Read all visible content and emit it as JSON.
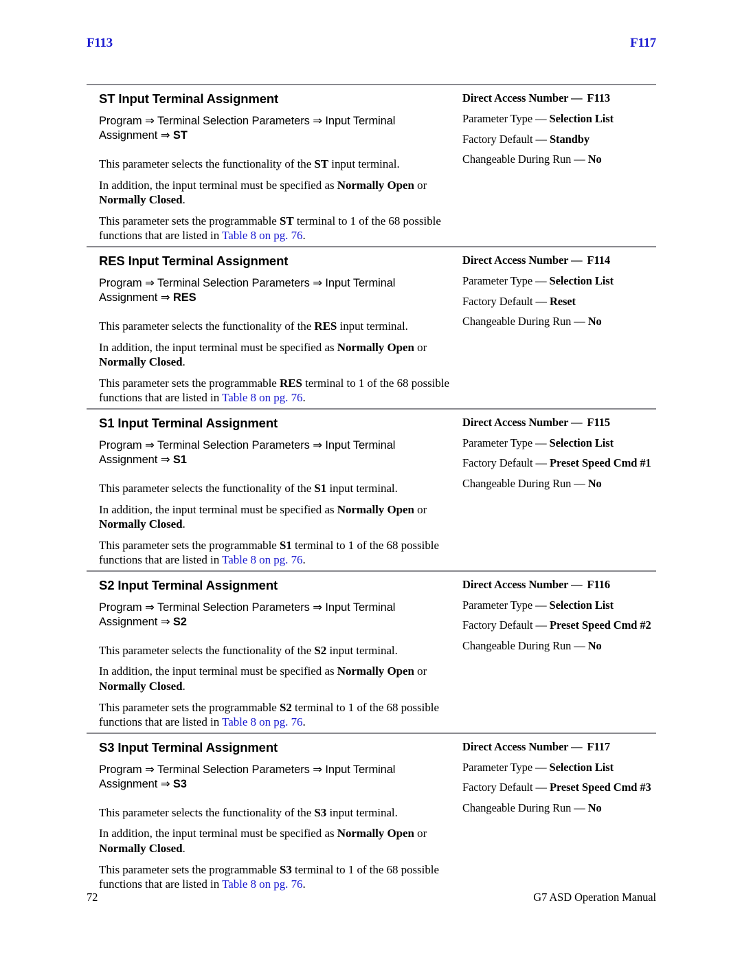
{
  "running_head": {
    "left": "F113",
    "right": "F117",
    "color": "#1a1ad0"
  },
  "link_color": "#1a1ad0",
  "rule_color": "#8a8a8f",
  "sections": [
    {
      "title": "ST Input Terminal Assignment",
      "path_prefix": "Program ⇒ Terminal Selection Parameters ⇒ Input Terminal Assignment ⇒ ",
      "path_terminal": "ST",
      "body": [
        {
          "p1": "This parameter selects the functionality of the ",
          "b1": "ST",
          "p2": " input terminal."
        },
        {
          "p1": "In addition, the input terminal must be specified as ",
          "b1": "Normally Open",
          "p2": " or ",
          "b2": "Normally Closed",
          "p3": "."
        },
        {
          "p1": "This parameter sets the programmable ",
          "b1": "ST",
          "p2": " terminal to 1 of the 68 possible functions that are listed in ",
          "link": "Table 8 on pg. 76",
          "p3": "."
        }
      ],
      "specs": {
        "direct_access_label": "Direct Access Number —",
        "direct_access_value": "F113",
        "parameter_type_label": "Parameter Type — ",
        "parameter_type_value": "Selection List",
        "factory_default_label": "Factory Default — ",
        "factory_default_value": "Standby",
        "changeable_label": "Changeable During Run — ",
        "changeable_value": "No"
      }
    },
    {
      "title": "RES Input Terminal Assignment",
      "path_prefix": "Program ⇒ Terminal Selection Parameters ⇒ Input Terminal Assignment ⇒ ",
      "path_terminal": "RES",
      "body": [
        {
          "p1": "This parameter selects the functionality of the ",
          "b1": "RES",
          "p2": " input terminal."
        },
        {
          "p1": "In addition, the input terminal must be specified as ",
          "b1": "Normally Open",
          "p2": " or ",
          "b2": "Normally Closed",
          "p3": "."
        },
        {
          "p1": "This parameter sets the programmable ",
          "b1": "RES",
          "p2": " terminal to 1 of the 68 possible functions that are listed in ",
          "link": "Table 8 on pg. 76",
          "p3": "."
        }
      ],
      "specs": {
        "direct_access_label": "Direct Access Number —",
        "direct_access_value": "F114",
        "parameter_type_label": "Parameter Type — ",
        "parameter_type_value": "Selection List",
        "factory_default_label": "Factory Default — ",
        "factory_default_value": "Reset",
        "changeable_label": "Changeable During Run — ",
        "changeable_value": "No"
      }
    },
    {
      "title": "S1 Input Terminal Assignment",
      "path_prefix": "Program ⇒ Terminal Selection Parameters ⇒ Input Terminal Assignment ⇒ ",
      "path_terminal": "S1",
      "body": [
        {
          "p1": "This parameter selects the functionality of the ",
          "b1": "S1",
          "p2": " input terminal."
        },
        {
          "p1": "In addition, the input terminal must be specified as ",
          "b1": "Normally Open",
          "p2": " or ",
          "b2": "Normally Closed",
          "p3": "."
        },
        {
          "p1": "This parameter sets the programmable ",
          "b1": "S1",
          "p2": " terminal to 1 of the 68 possible functions that are listed in ",
          "link": "Table 8 on pg. 76",
          "p3": "."
        }
      ],
      "specs": {
        "direct_access_label": "Direct Access Number —",
        "direct_access_value": "F115",
        "parameter_type_label": "Parameter Type — ",
        "parameter_type_value": "Selection List",
        "factory_default_label": "Factory Default — ",
        "factory_default_value": "Preset Speed Cmd #1",
        "changeable_label": "Changeable During Run — ",
        "changeable_value": "No"
      }
    },
    {
      "title": "S2 Input Terminal Assignment",
      "path_prefix": "Program ⇒ Terminal Selection Parameters ⇒ Input Terminal Assignment ⇒ ",
      "path_terminal": "S2",
      "body": [
        {
          "p1": "This parameter selects the functionality of the ",
          "b1": "S2",
          "p2": " input terminal."
        },
        {
          "p1": "In addition, the input terminal must be specified as ",
          "b1": "Normally Open",
          "p2": " or ",
          "b2": "Normally Closed",
          "p3": "."
        },
        {
          "p1": "This parameter sets the programmable ",
          "b1": "S2",
          "p2": " terminal to 1 of the 68 possible functions that are listed in ",
          "link": "Table 8 on pg. 76",
          "p3": "."
        }
      ],
      "specs": {
        "direct_access_label": "Direct Access Number —",
        "direct_access_value": "F116",
        "parameter_type_label": "Parameter Type — ",
        "parameter_type_value": "Selection List",
        "factory_default_label": "Factory Default — ",
        "factory_default_value": "Preset Speed Cmd #2",
        "changeable_label": "Changeable During Run — ",
        "changeable_value": "No"
      }
    },
    {
      "title": "S3 Input Terminal Assignment",
      "path_prefix": "Program ⇒ Terminal Selection Parameters ⇒ Input Terminal Assignment ⇒ ",
      "path_terminal": "S3",
      "body": [
        {
          "p1": "This parameter selects the functionality of the ",
          "b1": "S3",
          "p2": " input terminal."
        },
        {
          "p1": "In addition, the input terminal must be specified as ",
          "b1": "Normally Open",
          "p2": " or ",
          "b2": "Normally Closed",
          "p3": "."
        },
        {
          "p1": "This parameter sets the programmable ",
          "b1": "S3",
          "p2": " terminal to 1 of the 68 possible functions that are listed in ",
          "link": "Table 8 on pg. 76",
          "p3": "."
        }
      ],
      "specs": {
        "direct_access_label": "Direct Access Number —",
        "direct_access_value": "F117",
        "parameter_type_label": "Parameter Type — ",
        "parameter_type_value": "Selection List",
        "factory_default_label": "Factory Default — ",
        "factory_default_value": "Preset Speed Cmd #3",
        "changeable_label": "Changeable During Run — ",
        "changeable_value": "No"
      }
    }
  ],
  "footer": {
    "page_number": "72",
    "manual_title": "G7 ASD Operation Manual"
  }
}
